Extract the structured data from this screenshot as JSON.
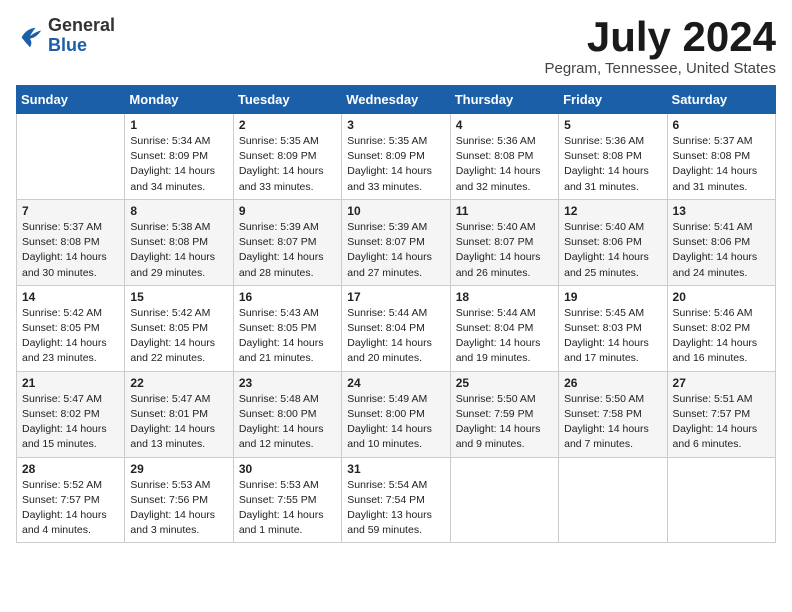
{
  "header": {
    "logo_general": "General",
    "logo_blue": "Blue",
    "month": "July 2024",
    "location": "Pegram, Tennessee, United States"
  },
  "weekdays": [
    "Sunday",
    "Monday",
    "Tuesday",
    "Wednesday",
    "Thursday",
    "Friday",
    "Saturday"
  ],
  "weeks": [
    [
      {
        "day": "",
        "info": ""
      },
      {
        "day": "1",
        "info": "Sunrise: 5:34 AM\nSunset: 8:09 PM\nDaylight: 14 hours\nand 34 minutes."
      },
      {
        "day": "2",
        "info": "Sunrise: 5:35 AM\nSunset: 8:09 PM\nDaylight: 14 hours\nand 33 minutes."
      },
      {
        "day": "3",
        "info": "Sunrise: 5:35 AM\nSunset: 8:09 PM\nDaylight: 14 hours\nand 33 minutes."
      },
      {
        "day": "4",
        "info": "Sunrise: 5:36 AM\nSunset: 8:08 PM\nDaylight: 14 hours\nand 32 minutes."
      },
      {
        "day": "5",
        "info": "Sunrise: 5:36 AM\nSunset: 8:08 PM\nDaylight: 14 hours\nand 31 minutes."
      },
      {
        "day": "6",
        "info": "Sunrise: 5:37 AM\nSunset: 8:08 PM\nDaylight: 14 hours\nand 31 minutes."
      }
    ],
    [
      {
        "day": "7",
        "info": "Sunrise: 5:37 AM\nSunset: 8:08 PM\nDaylight: 14 hours\nand 30 minutes."
      },
      {
        "day": "8",
        "info": "Sunrise: 5:38 AM\nSunset: 8:08 PM\nDaylight: 14 hours\nand 29 minutes."
      },
      {
        "day": "9",
        "info": "Sunrise: 5:39 AM\nSunset: 8:07 PM\nDaylight: 14 hours\nand 28 minutes."
      },
      {
        "day": "10",
        "info": "Sunrise: 5:39 AM\nSunset: 8:07 PM\nDaylight: 14 hours\nand 27 minutes."
      },
      {
        "day": "11",
        "info": "Sunrise: 5:40 AM\nSunset: 8:07 PM\nDaylight: 14 hours\nand 26 minutes."
      },
      {
        "day": "12",
        "info": "Sunrise: 5:40 AM\nSunset: 8:06 PM\nDaylight: 14 hours\nand 25 minutes."
      },
      {
        "day": "13",
        "info": "Sunrise: 5:41 AM\nSunset: 8:06 PM\nDaylight: 14 hours\nand 24 minutes."
      }
    ],
    [
      {
        "day": "14",
        "info": "Sunrise: 5:42 AM\nSunset: 8:05 PM\nDaylight: 14 hours\nand 23 minutes."
      },
      {
        "day": "15",
        "info": "Sunrise: 5:42 AM\nSunset: 8:05 PM\nDaylight: 14 hours\nand 22 minutes."
      },
      {
        "day": "16",
        "info": "Sunrise: 5:43 AM\nSunset: 8:05 PM\nDaylight: 14 hours\nand 21 minutes."
      },
      {
        "day": "17",
        "info": "Sunrise: 5:44 AM\nSunset: 8:04 PM\nDaylight: 14 hours\nand 20 minutes."
      },
      {
        "day": "18",
        "info": "Sunrise: 5:44 AM\nSunset: 8:04 PM\nDaylight: 14 hours\nand 19 minutes."
      },
      {
        "day": "19",
        "info": "Sunrise: 5:45 AM\nSunset: 8:03 PM\nDaylight: 14 hours\nand 17 minutes."
      },
      {
        "day": "20",
        "info": "Sunrise: 5:46 AM\nSunset: 8:02 PM\nDaylight: 14 hours\nand 16 minutes."
      }
    ],
    [
      {
        "day": "21",
        "info": "Sunrise: 5:47 AM\nSunset: 8:02 PM\nDaylight: 14 hours\nand 15 minutes."
      },
      {
        "day": "22",
        "info": "Sunrise: 5:47 AM\nSunset: 8:01 PM\nDaylight: 14 hours\nand 13 minutes."
      },
      {
        "day": "23",
        "info": "Sunrise: 5:48 AM\nSunset: 8:00 PM\nDaylight: 14 hours\nand 12 minutes."
      },
      {
        "day": "24",
        "info": "Sunrise: 5:49 AM\nSunset: 8:00 PM\nDaylight: 14 hours\nand 10 minutes."
      },
      {
        "day": "25",
        "info": "Sunrise: 5:50 AM\nSunset: 7:59 PM\nDaylight: 14 hours\nand 9 minutes."
      },
      {
        "day": "26",
        "info": "Sunrise: 5:50 AM\nSunset: 7:58 PM\nDaylight: 14 hours\nand 7 minutes."
      },
      {
        "day": "27",
        "info": "Sunrise: 5:51 AM\nSunset: 7:57 PM\nDaylight: 14 hours\nand 6 minutes."
      }
    ],
    [
      {
        "day": "28",
        "info": "Sunrise: 5:52 AM\nSunset: 7:57 PM\nDaylight: 14 hours\nand 4 minutes."
      },
      {
        "day": "29",
        "info": "Sunrise: 5:53 AM\nSunset: 7:56 PM\nDaylight: 14 hours\nand 3 minutes."
      },
      {
        "day": "30",
        "info": "Sunrise: 5:53 AM\nSunset: 7:55 PM\nDaylight: 14 hours\nand 1 minute."
      },
      {
        "day": "31",
        "info": "Sunrise: 5:54 AM\nSunset: 7:54 PM\nDaylight: 13 hours\nand 59 minutes."
      },
      {
        "day": "",
        "info": ""
      },
      {
        "day": "",
        "info": ""
      },
      {
        "day": "",
        "info": ""
      }
    ]
  ]
}
